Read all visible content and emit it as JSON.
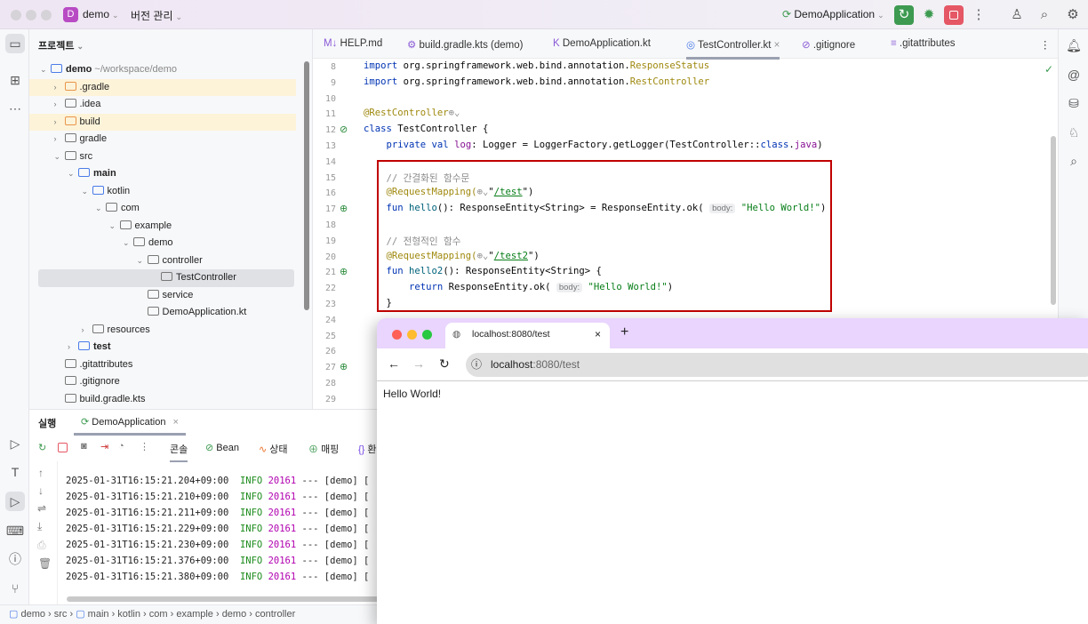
{
  "titlebar": {
    "project_initial": "D",
    "project": "demo",
    "vcs": "버전 관리",
    "run_config": "DemoApplication"
  },
  "project_panel": {
    "title": "프로젝트",
    "tree": [
      {
        "label": "demo",
        "extra": "~/workspace/demo",
        "depth": 0,
        "open": "v",
        "icon": "module",
        "bold": true
      },
      {
        "label": ".gradle",
        "depth": 1,
        "open": ">",
        "icon": "folder-excluded",
        "hl": true
      },
      {
        "label": ".idea",
        "depth": 1,
        "open": ">",
        "icon": "folder"
      },
      {
        "label": "build",
        "depth": 1,
        "open": ">",
        "icon": "folder-excluded",
        "hl": true
      },
      {
        "label": "gradle",
        "depth": 1,
        "open": ">",
        "icon": "folder"
      },
      {
        "label": "src",
        "depth": 1,
        "open": "v",
        "icon": "folder"
      },
      {
        "label": "main",
        "depth": 2,
        "open": "v",
        "icon": "module",
        "bold": true
      },
      {
        "label": "kotlin",
        "depth": 3,
        "open": "v",
        "icon": "source-folder"
      },
      {
        "label": "com",
        "depth": 4,
        "open": "v",
        "icon": "package"
      },
      {
        "label": "example",
        "depth": 5,
        "open": "v",
        "icon": "package"
      },
      {
        "label": "demo",
        "depth": 6,
        "open": "v",
        "icon": "package"
      },
      {
        "label": "controller",
        "depth": 7,
        "open": "v",
        "icon": "package"
      },
      {
        "label": "TestController",
        "depth": 8,
        "open": "",
        "icon": "spring-class",
        "sel": true
      },
      {
        "label": "service",
        "depth": 7,
        "open": "",
        "icon": "package"
      },
      {
        "label": "DemoApplication.kt",
        "depth": 7,
        "open": "",
        "icon": "kotlin-file"
      },
      {
        "label": "resources",
        "depth": 3,
        "open": ">",
        "icon": "resources-folder"
      },
      {
        "label": "test",
        "depth": 2,
        "open": ">",
        "icon": "module",
        "bold": true
      },
      {
        "label": ".gitattributes",
        "depth": 1,
        "open": "",
        "icon": "text-file"
      },
      {
        "label": ".gitignore",
        "depth": 1,
        "open": "",
        "icon": "ignore-file"
      },
      {
        "label": "build.gradle.kts",
        "depth": 1,
        "open": "",
        "icon": "gradle-file"
      }
    ]
  },
  "editor": {
    "tabs": [
      {
        "label": "HELP.md",
        "icon": "M↓"
      },
      {
        "label": "build.gradle.kts (demo)",
        "icon": "⚙"
      },
      {
        "label": "DemoApplication.kt",
        "icon": "K"
      },
      {
        "label": "TestController.kt",
        "icon": "◎",
        "active": true
      },
      {
        "label": ".gitignore",
        "icon": "⊘"
      },
      {
        "label": ".gitattributes",
        "icon": "≡"
      }
    ],
    "lines": [
      {
        "n": "8",
        "t": [
          [
            "import ",
            "kw"
          ],
          [
            "org.springframework.web.bind.annotation.",
            ""
          ],
          [
            "ResponseStatus",
            "an"
          ]
        ]
      },
      {
        "n": "9",
        "t": [
          [
            "import ",
            "kw"
          ],
          [
            "org.springframework.web.bind.annotation.",
            ""
          ],
          [
            "RestController",
            "an"
          ]
        ]
      },
      {
        "n": "10",
        "t": []
      },
      {
        "n": "11",
        "t": [
          [
            "@RestController",
            "an"
          ],
          [
            "⊕⌄",
            "cm"
          ]
        ]
      },
      {
        "n": "12",
        "g": "⊘",
        "t": [
          [
            "class ",
            "kw"
          ],
          [
            "TestController {",
            ""
          ]
        ]
      },
      {
        "n": "13",
        "t": [
          [
            "    private val ",
            "kw"
          ],
          [
            "log",
            "pr"
          ],
          [
            ": Logger = LoggerFactory.getLogger(TestController::",
            ""
          ],
          [
            "class",
            "kw"
          ],
          [
            ".",
            ""
          ],
          [
            "java",
            "pr"
          ],
          [
            ")",
            ""
          ]
        ]
      },
      {
        "n": "14",
        "t": []
      },
      {
        "n": "15",
        "t": [
          [
            "    // 간결화된 함수문",
            "cm"
          ]
        ]
      },
      {
        "n": "16",
        "t": [
          [
            "    @RequestMapping(",
            "an"
          ],
          [
            "⊕⌄",
            "cm"
          ],
          [
            "\"",
            ""
          ],
          [
            "/test",
            "lk"
          ],
          [
            "\")",
            ""
          ]
        ]
      },
      {
        "n": "17",
        "g": "⊕",
        "t": [
          [
            "    fun ",
            "kw"
          ],
          [
            "hello",
            "fn"
          ],
          [
            "(): ResponseEntity<String> = ResponseEntity.ok( ",
            ""
          ],
          [
            "body:",
            "hint"
          ],
          [
            " \"Hello World!\"",
            "st"
          ],
          [
            ")",
            ""
          ]
        ]
      },
      {
        "n": "18",
        "t": []
      },
      {
        "n": "19",
        "t": [
          [
            "    // 전형적인 함수",
            "cm"
          ]
        ]
      },
      {
        "n": "20",
        "t": [
          [
            "    @RequestMapping(",
            "an"
          ],
          [
            "⊕⌄",
            "cm"
          ],
          [
            "\"",
            ""
          ],
          [
            "/test2",
            "lk"
          ],
          [
            "\")",
            ""
          ]
        ]
      },
      {
        "n": "21",
        "g": "⊕",
        "t": [
          [
            "    fun ",
            "kw"
          ],
          [
            "hello2",
            "fn"
          ],
          [
            "(): ResponseEntity<String> {",
            ""
          ]
        ]
      },
      {
        "n": "22",
        "t": [
          [
            "        return ",
            "kw"
          ],
          [
            "ResponseEntity.ok( ",
            ""
          ],
          [
            "body:",
            "hint"
          ],
          [
            " \"Hello World!\"",
            "st"
          ],
          [
            ")",
            ""
          ]
        ]
      },
      {
        "n": "23",
        "t": [
          [
            "    }",
            ""
          ]
        ]
      },
      {
        "n": "24",
        "t": []
      },
      {
        "n": "25",
        "t": []
      },
      {
        "n": "26",
        "t": []
      },
      {
        "n": "27",
        "g": "⊕",
        "t": []
      },
      {
        "n": "28",
        "t": []
      },
      {
        "n": "29",
        "t": []
      }
    ]
  },
  "run_panel": {
    "title": "실행",
    "tab": "DemoApplication",
    "toolbar_tabs": [
      "콘솔",
      "Bean",
      "상태",
      "매핑",
      "환"
    ],
    "logs": [
      {
        "ts": "2025-01-31T16:15:21.204+09:00",
        "level": "INFO",
        "pid": "20161",
        "rest": " --- [demo] ["
      },
      {
        "ts": "2025-01-31T16:15:21.210+09:00",
        "level": "INFO",
        "pid": "20161",
        "rest": " --- [demo] ["
      },
      {
        "ts": "2025-01-31T16:15:21.211+09:00",
        "level": "INFO",
        "pid": "20161",
        "rest": " --- [demo] ["
      },
      {
        "ts": "2025-01-31T16:15:21.229+09:00",
        "level": "INFO",
        "pid": "20161",
        "rest": " --- [demo] ["
      },
      {
        "ts": "2025-01-31T16:15:21.230+09:00",
        "level": "INFO",
        "pid": "20161",
        "rest": " --- [demo] ["
      },
      {
        "ts": "2025-01-31T16:15:21.376+09:00",
        "level": "INFO",
        "pid": "20161",
        "rest": " --- [demo] ["
      },
      {
        "ts": "2025-01-31T16:15:21.380+09:00",
        "level": "INFO",
        "pid": "20161",
        "rest": " --- [demo] ["
      }
    ]
  },
  "breadcrumb": [
    "demo",
    "src",
    "main",
    "kotlin",
    "com",
    "example",
    "demo",
    "controller"
  ],
  "browser": {
    "tab_title": "localhost:8080/test",
    "url_host": "localhost",
    "url_rest": ":8080/test",
    "body": "Hello World!"
  },
  "colors": {
    "highlight_box": "#c00000",
    "run_green": "#3d9a50",
    "stop_red": "#e55765",
    "browser_tabbar": "#e9d5fd"
  }
}
